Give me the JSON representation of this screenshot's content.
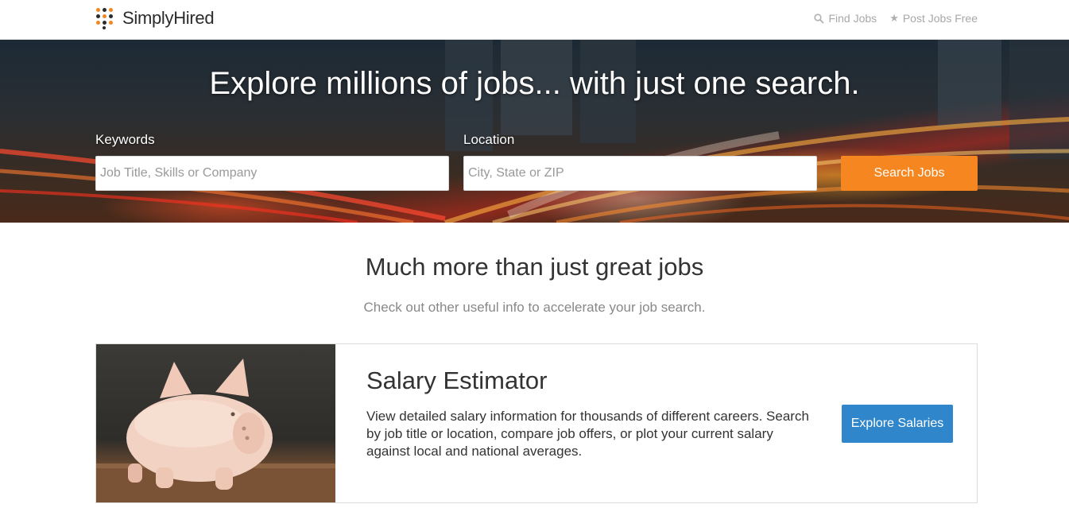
{
  "header": {
    "logo_text": "SimplyHired",
    "nav": [
      {
        "label": "Find Jobs",
        "icon": "search-icon"
      },
      {
        "label": "Post Jobs Free",
        "icon": "star-icon"
      }
    ]
  },
  "hero": {
    "headline": "Explore millions of jobs... with just one search.",
    "keywords_label": "Keywords",
    "keywords_placeholder": "Job Title, Skills or Company",
    "location_label": "Location",
    "location_placeholder": "City, State or ZIP",
    "search_button": "Search Jobs"
  },
  "section": {
    "title": "Much more than just great jobs",
    "subtitle": "Check out other useful info to accelerate your job search."
  },
  "card": {
    "title": "Salary Estimator",
    "description": "View detailed salary information for thousands of different careers. Search by job title or location, compare job offers, or plot your current salary against local and national averages.",
    "button": "Explore Salaries"
  },
  "colors": {
    "search_button": "#f6861f",
    "explore_button": "#2f86cb",
    "logo_orange": "#f6861f",
    "logo_dark": "#2b2b2b"
  }
}
